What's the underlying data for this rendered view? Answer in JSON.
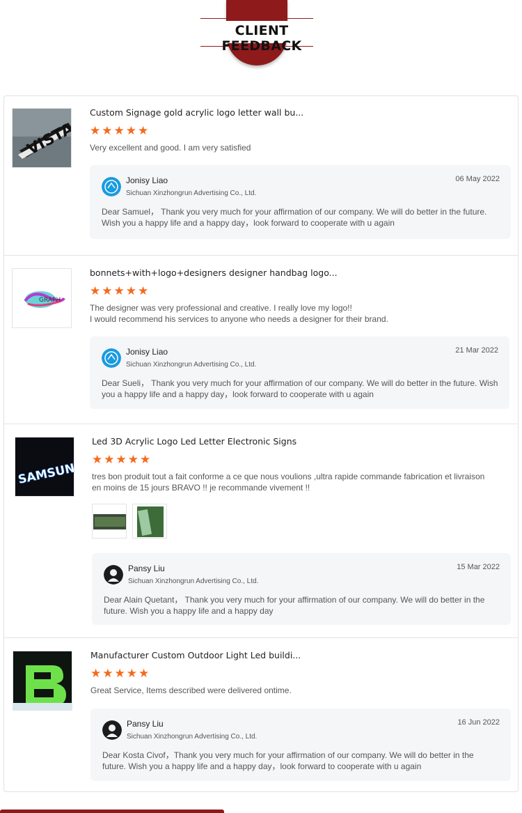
{
  "section_title": "CLIENT FEEDBACK",
  "colors": {
    "accent": "#8e1a1c",
    "star": "#f56a1c",
    "reply_bg": "#f5f6f8"
  },
  "reviews": [
    {
      "product_title": "Custom Signage gold acrylic logo letter wall bu...",
      "rating": 5,
      "comment": "Very excellent and good. I am very satisfied",
      "reply": {
        "name": "Jonisy Liao",
        "company": "Sichuan Xinzhongrun Advertising Co., Ltd.",
        "date": "06 May 2022",
        "text": "Dear Samuel， Thank you very much for your affirmation of our company. We will do better in the future. Wish you a happy life and a happy day，look forward to cooperate with u again"
      }
    },
    {
      "product_title": "bonnets+with+logo+designers designer handbag logo...",
      "rating": 5,
      "comment": "The designer was very professional and creative. I really love my logo!!\nI would recommend his services to anyone who needs a designer for their brand.",
      "reply": {
        "name": "Jonisy Liao",
        "company": "Sichuan Xinzhongrun Advertising Co., Ltd.",
        "date": "21 Mar 2022",
        "text": "Dear Sueli， Thank you very much for your affirmation of our company. We will do better in the future. Wish you a happy life and a happy day，look forward to cooperate with u again"
      }
    },
    {
      "product_title": "Led 3D Acrylic Logo Led Letter Electronic Signs",
      "thumb_text": "SAMSUNG",
      "rating": 5,
      "comment": "tres bon produit tout a fait conforme a ce que nous voulions ,ultra rapide commande fabrication et livraison en moins de 15 jours BRAVO !! je recommande vivement !!",
      "reply": {
        "name": "Pansy Liu",
        "company": "Sichuan Xinzhongrun Advertising Co., Ltd.",
        "date": "15 Mar 2022",
        "text": "Dear Alain Quetant， Thank you very much for your affirmation of our company. We will do better in the future. Wish you a happy life and a happy day"
      }
    },
    {
      "product_title": "Manufacturer Custom Outdoor Light Led buildi...",
      "rating": 5,
      "comment": "Great Service, Items described were delivered ontime.",
      "reply": {
        "name": "Pansy Liu",
        "company": "Sichuan Xinzhongrun Advertising Co., Ltd.",
        "date": "16 Jun 2022",
        "text": "Dear Kosta Civof，Thank you very much for your affirmation of our company. We will do better in the future. Wish you a happy life and a happy day，look forward to cooperate with u again"
      }
    }
  ]
}
